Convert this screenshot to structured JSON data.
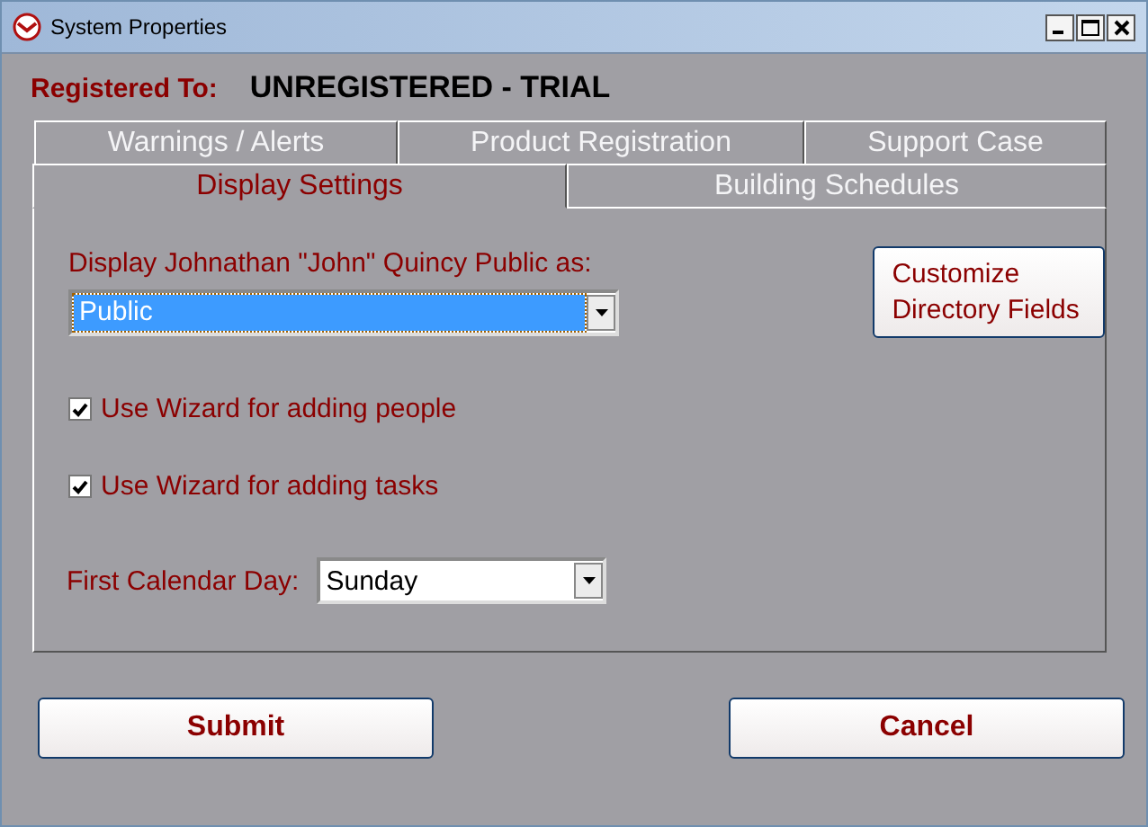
{
  "window": {
    "title": "System Properties"
  },
  "registration": {
    "label": "Registered To:",
    "value": "UNREGISTERED - TRIAL"
  },
  "tab_rows": [
    [
      {
        "label": "Warnings / Alerts",
        "selected": false
      },
      {
        "label": "Product Registration",
        "selected": false
      },
      {
        "label": "Support Case",
        "selected": false
      }
    ],
    [
      {
        "label": "Display Settings",
        "selected": true
      },
      {
        "label": "Building Schedules",
        "selected": false
      }
    ]
  ],
  "display_as": {
    "label": "Display Johnathan \"John\" Quincy Public as:",
    "value": "Public"
  },
  "customize_button": "Customize Directory Fields",
  "checkboxes": [
    {
      "label": "Use Wizard for adding people",
      "checked": true
    },
    {
      "label": "Use Wizard for adding tasks",
      "checked": true
    }
  ],
  "first_day": {
    "label": "First Calendar Day:",
    "value": "Sunday"
  },
  "buttons": [
    "Submit",
    "Cancel"
  ]
}
